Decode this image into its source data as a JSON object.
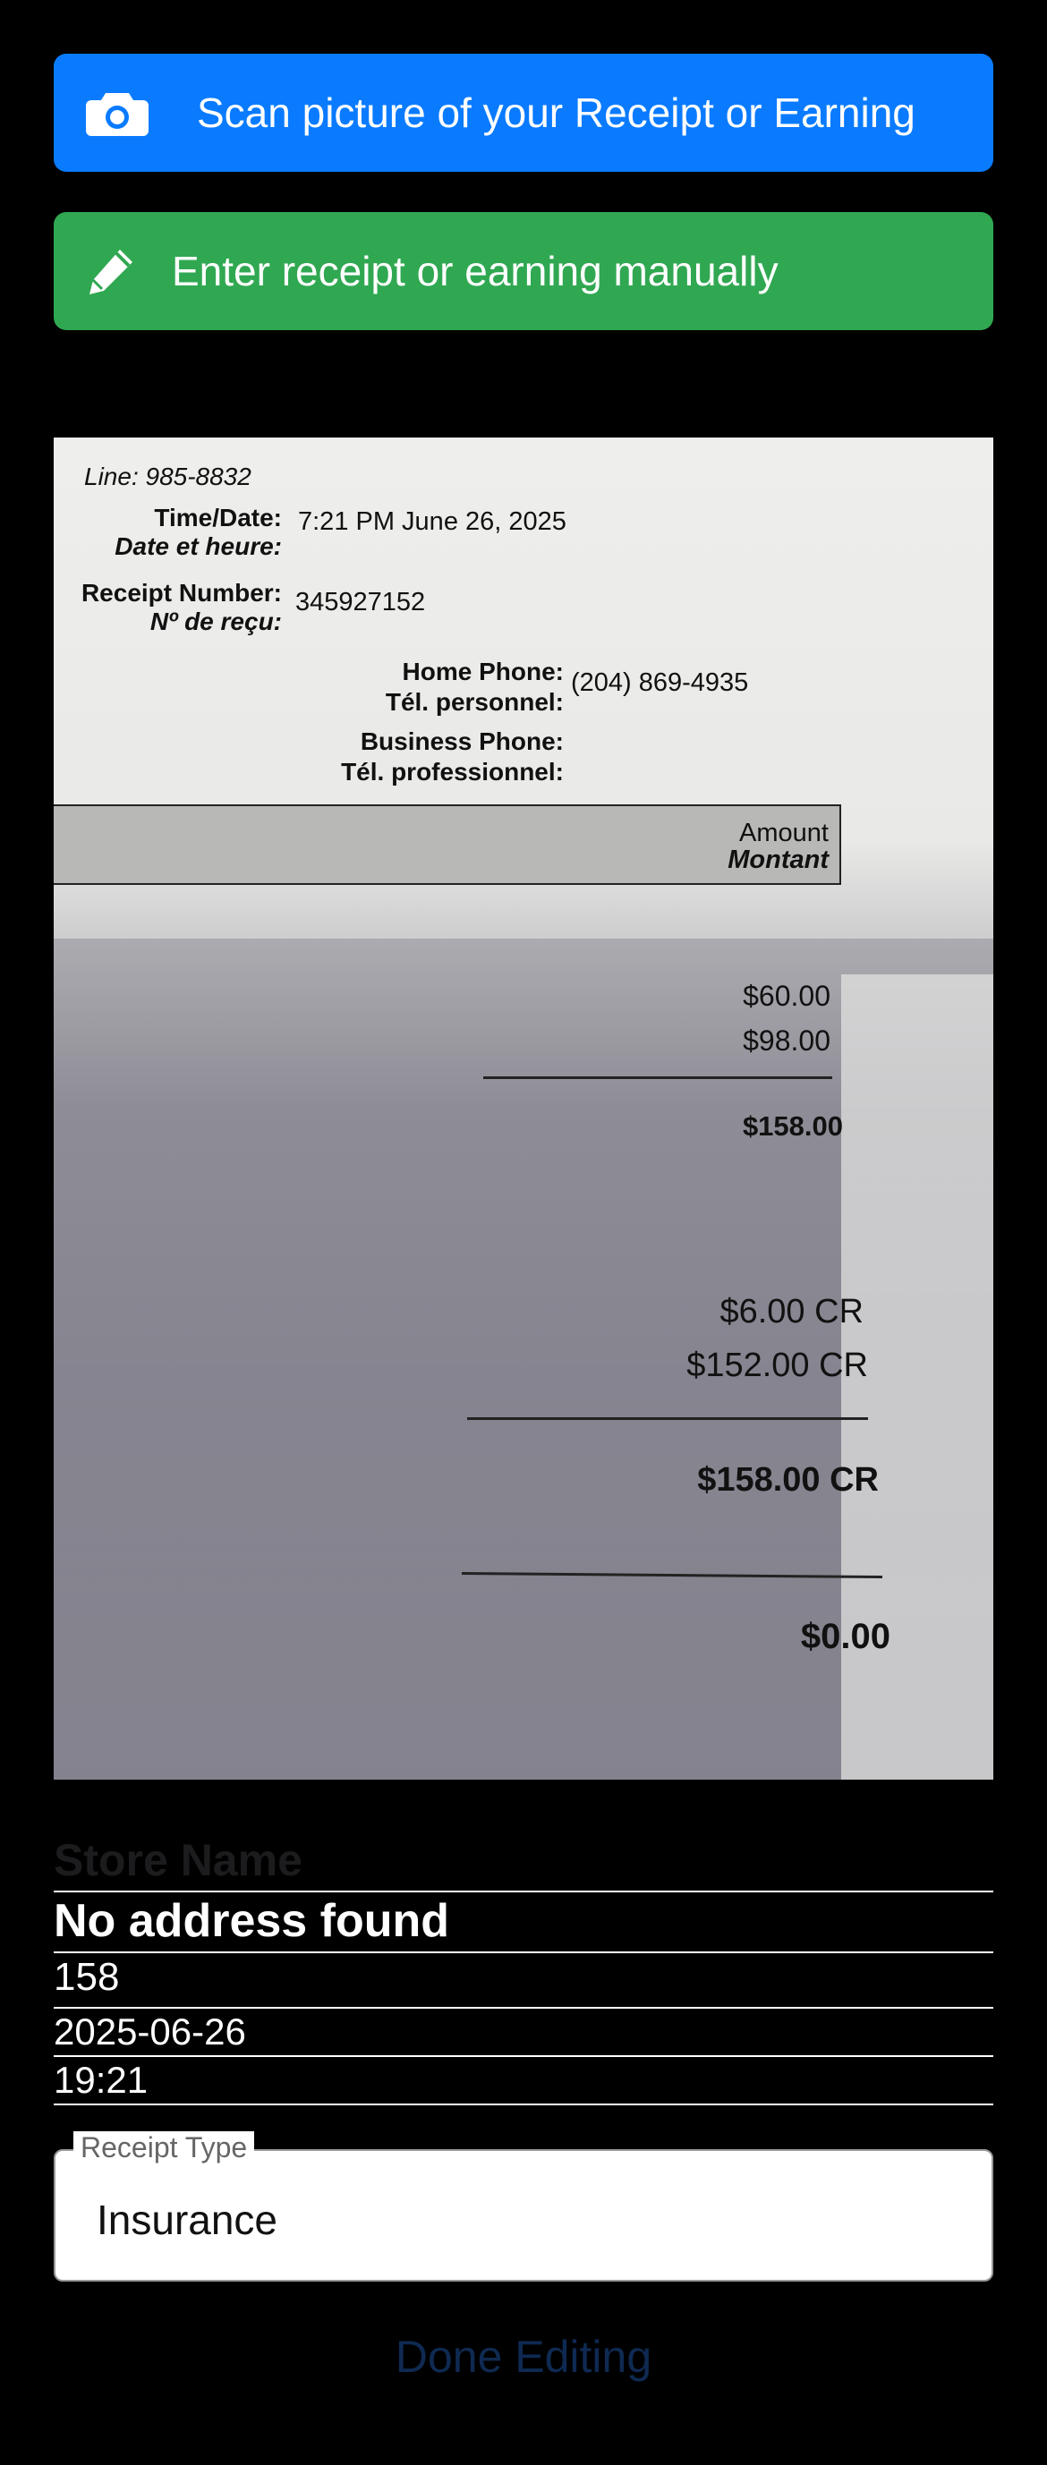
{
  "buttons": {
    "scan_label": "Scan picture of your Receipt or Earning",
    "manual_label": "Enter receipt or earning manually",
    "scan_color": "#0a7bff",
    "manual_color": "#30a852"
  },
  "receipt_image": {
    "line": "Line: 985-8832",
    "time_date_label_en": "Time/Date:",
    "time_date_label_fr": "Date et heure:",
    "time_date_value": "7:21 PM June 26, 2025",
    "receipt_number_label_en": "Receipt Number:",
    "receipt_number_label_fr": "Nº de reçu:",
    "receipt_number_value": "345927152",
    "home_phone_label_en": "Home Phone:",
    "home_phone_label_fr": "Tél. personnel:",
    "home_phone_value": "(204) 869-4935",
    "business_phone_label_en": "Business Phone:",
    "business_phone_label_fr": "Tél. professionnel:",
    "amount_header_en": "Amount",
    "amount_header_fr": "Montant",
    "amounts": [
      "$60.00",
      "$98.00"
    ],
    "subtotal": "$158.00",
    "credits": [
      "$6.00 CR",
      "$152.00 CR"
    ],
    "credit_total": "$158.00 CR",
    "balance": "$0.00"
  },
  "form": {
    "store_name_placeholder": "Store Name",
    "address": "No address found",
    "amount": "158",
    "date": "2025-06-26",
    "time": "19:21",
    "receipt_type_label": "Receipt Type",
    "receipt_type_value": "Insurance",
    "done_label": "Done Editing"
  }
}
